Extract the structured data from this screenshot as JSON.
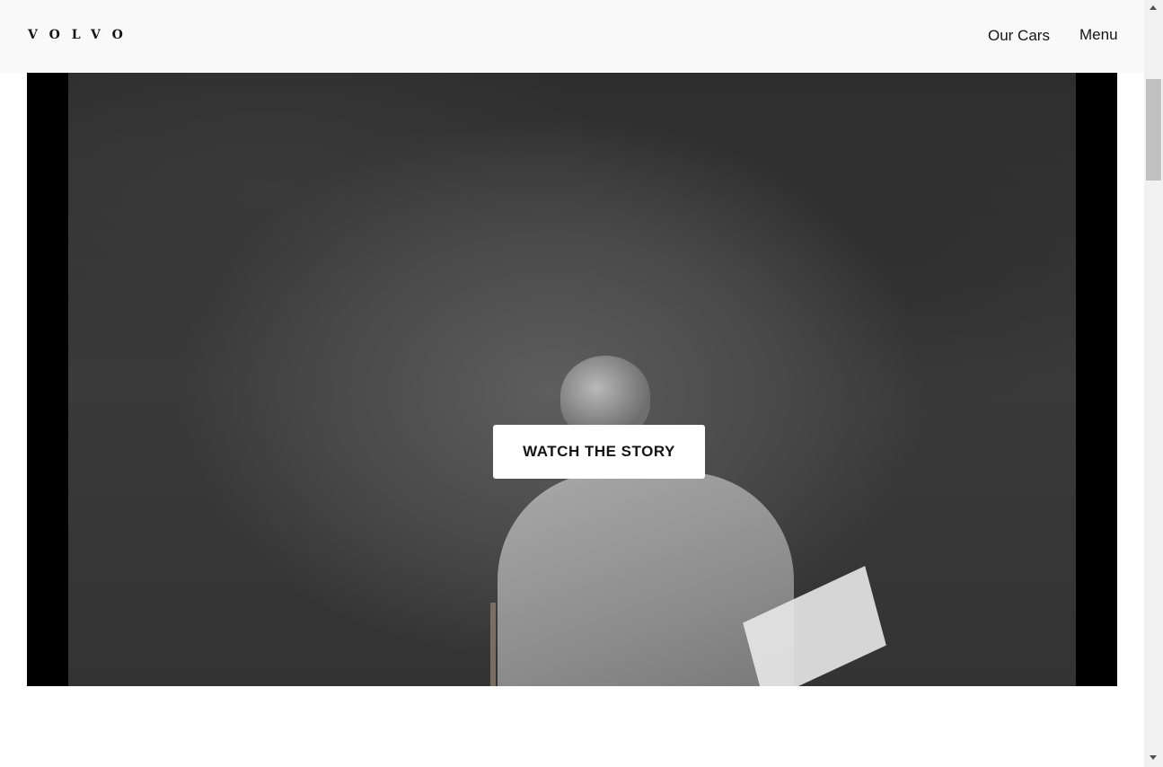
{
  "header": {
    "logo": "VOLVO",
    "nav": {
      "our_cars": "Our Cars",
      "menu": "Menu"
    }
  },
  "hero": {
    "cta_label": "WATCH THE STORY",
    "pause_icon": "pause-icon"
  },
  "colors": {
    "header_bg": "#f9f9f9",
    "text": "#141414",
    "button_bg": "#ffffff",
    "pause_bg": "#bdbdbd"
  }
}
